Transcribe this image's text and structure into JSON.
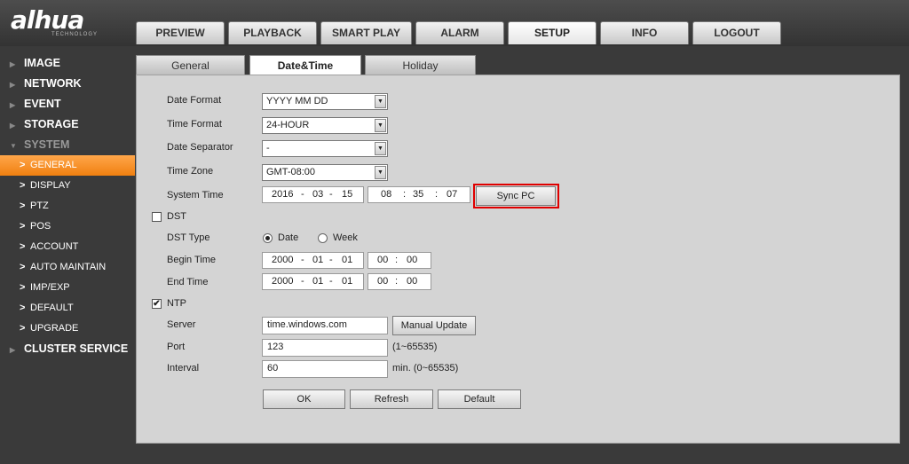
{
  "brand": {
    "logo": "alhua",
    "sub": "TECHNOLOGY"
  },
  "topnav": [
    "PREVIEW",
    "PLAYBACK",
    "SMART PLAY",
    "ALARM",
    "SETUP",
    "INFO",
    "LOGOUT"
  ],
  "sidebar": {
    "main_top": [
      "IMAGE",
      "NETWORK",
      "EVENT",
      "STORAGE"
    ],
    "system": "SYSTEM",
    "sub": [
      "GENERAL",
      "DISPLAY",
      "PTZ",
      "POS",
      "ACCOUNT",
      "AUTO MAINTAIN",
      "IMP/EXP",
      "DEFAULT",
      "UPGRADE"
    ],
    "cluster": "CLUSTER SERVICE"
  },
  "subtabs": [
    "General",
    "Date&Time",
    "Holiday"
  ],
  "form": {
    "date_format": {
      "label": "Date Format",
      "value": "YYYY MM DD"
    },
    "time_format": {
      "label": "Time Format",
      "value": "24-HOUR"
    },
    "date_separator": {
      "label": "Date Separator",
      "value": "-"
    },
    "time_zone": {
      "label": "Time Zone",
      "value": "GMT-08:00"
    },
    "system_time": {
      "label": "System Time",
      "year": "2016",
      "month": "03",
      "day": "15",
      "hour": "08",
      "min": "35",
      "sec": "07",
      "sep_date": "-",
      "sep_time": ":"
    },
    "sync_pc": "Sync PC",
    "dst": {
      "label": "DST",
      "checked": false
    },
    "dst_type": {
      "label": "DST Type",
      "opt1": "Date",
      "opt2": "Week",
      "selected": "Date"
    },
    "begin_time": {
      "label": "Begin Time",
      "year": "2000",
      "month": "01",
      "day": "01",
      "hour": "00",
      "min": "00"
    },
    "end_time": {
      "label": "End Time",
      "year": "2000",
      "month": "01",
      "day": "01",
      "hour": "00",
      "min": "00"
    },
    "ntp": {
      "label": "NTP",
      "checked": true,
      "mark": "✔"
    },
    "server": {
      "label": "Server",
      "value": "time.windows.com",
      "button": "Manual Update"
    },
    "port": {
      "label": "Port",
      "value": "123",
      "hint": "(1~65535)"
    },
    "interval": {
      "label": "Interval",
      "value": "60",
      "hint": "min. (0~65535)"
    },
    "buttons": {
      "ok": "OK",
      "refresh": "Refresh",
      "default": "Default"
    }
  },
  "colors": {
    "accent": "#f08010",
    "highlight": "#e00000"
  }
}
